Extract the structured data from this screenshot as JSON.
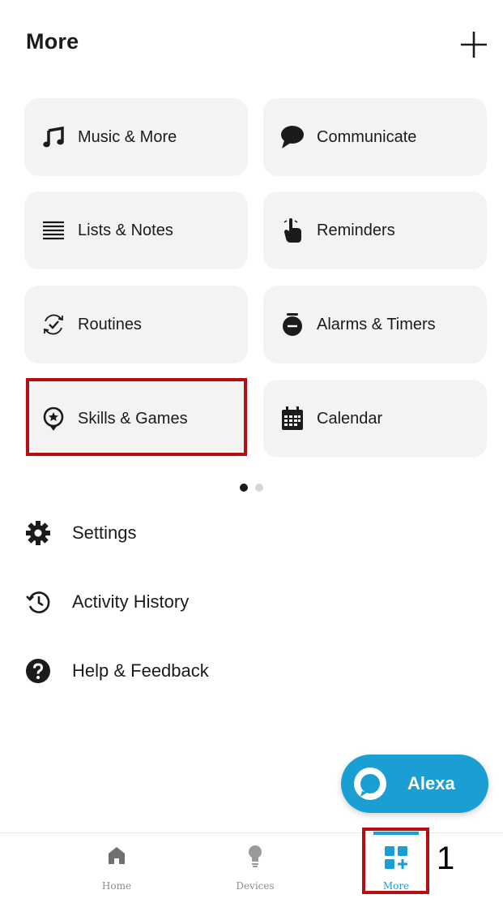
{
  "header": {
    "title": "More",
    "add_symbol": "+"
  },
  "tiles": [
    {
      "label": "Music & More",
      "icon": "music-note-icon"
    },
    {
      "label": "Communicate",
      "icon": "speech-bubble-icon"
    },
    {
      "label": "Lists & Notes",
      "icon": "list-icon"
    },
    {
      "label": "Reminders",
      "icon": "hand-pointing-icon"
    },
    {
      "label": "Routines",
      "icon": "routine-check-icon"
    },
    {
      "label": "Alarms & Timers",
      "icon": "alarm-clock-icon"
    },
    {
      "label": "Skills & Games",
      "icon": "skills-badge-icon"
    },
    {
      "label": "Calendar",
      "icon": "calendar-icon"
    }
  ],
  "pager": {
    "pages": 2,
    "current": 1
  },
  "menu": [
    {
      "label": "Settings",
      "icon": "gear-icon"
    },
    {
      "label": "Activity History",
      "icon": "history-icon"
    },
    {
      "label": "Help & Feedback",
      "icon": "help-icon"
    }
  ],
  "alexa_button": {
    "label": "Alexa",
    "icon": "alexa-ring-icon"
  },
  "nav": [
    {
      "label": "Home",
      "icon": "home-icon"
    },
    {
      "label": "Devices",
      "icon": "lightbulb-icon"
    },
    {
      "label": "More",
      "icon": "more-grid-icon",
      "active": true
    }
  ],
  "annotation": {
    "number": "1"
  },
  "colors": {
    "accent": "#1a9ed4",
    "highlight": "#b50d10",
    "tile_bg": "#f3f3f3"
  }
}
